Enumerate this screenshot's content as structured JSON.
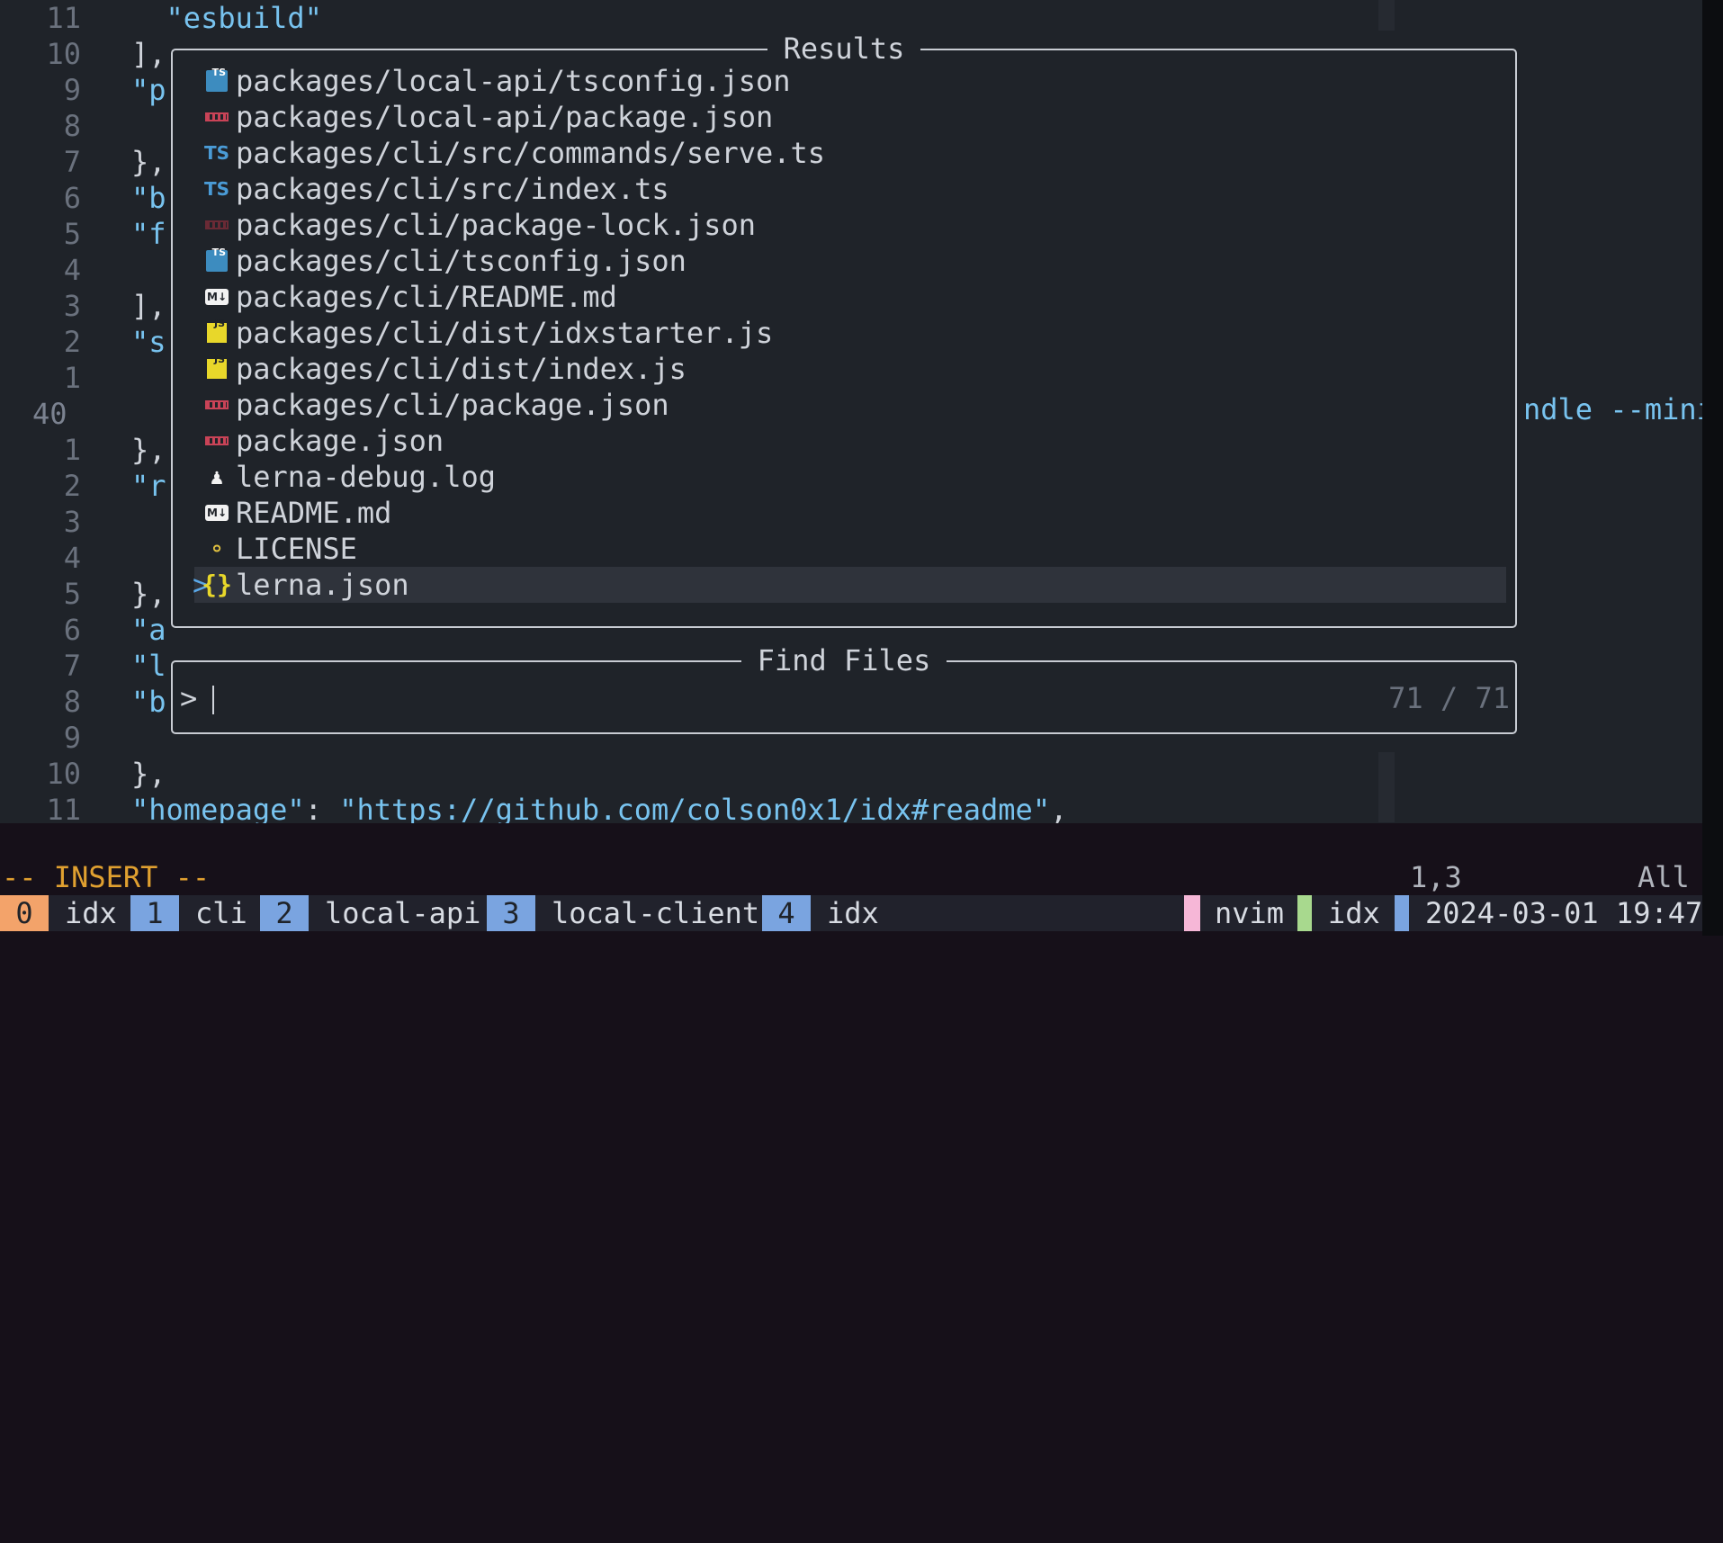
{
  "editor": {
    "lines": [
      {
        "num": "11",
        "code": "  \"esbuild\""
      },
      {
        "num": "10",
        "code": "],"
      },
      {
        "num": "9",
        "code": "\"p"
      },
      {
        "num": "8",
        "code": ""
      },
      {
        "num": "7",
        "code": "},"
      },
      {
        "num": "6",
        "code": "\"b"
      },
      {
        "num": "5",
        "code": "\"f"
      },
      {
        "num": "4",
        "code": ""
      },
      {
        "num": "3",
        "code": "],"
      },
      {
        "num": "2",
        "code": "\"s"
      },
      {
        "num": "1",
        "code": ""
      },
      {
        "num": "40",
        "code": ""
      },
      {
        "num": "1",
        "code": "},"
      },
      {
        "num": "2",
        "code": "\"r"
      },
      {
        "num": "3",
        "code": ""
      },
      {
        "num": "4",
        "code": ""
      },
      {
        "num": "5",
        "code": "},"
      },
      {
        "num": "6",
        "code": "\"a"
      },
      {
        "num": "7",
        "code": "\"l"
      },
      {
        "num": "8",
        "code": "\"b"
      },
      {
        "num": "9",
        "code": ""
      },
      {
        "num": "10",
        "code": "},"
      },
      {
        "num": "11",
        "code": "\"homepage\": \"https://github.com/colson0x1/idx#readme\","
      }
    ],
    "overflow_text": "ndle --mini"
  },
  "results": {
    "title": "Results",
    "items": [
      {
        "icon": "typescript-config-icon",
        "path": "packages/local-api/tsconfig.json"
      },
      {
        "icon": "npm-icon",
        "path": "packages/local-api/package.json"
      },
      {
        "icon": "typescript-icon",
        "path": "packages/cli/src/commands/serve.ts"
      },
      {
        "icon": "typescript-icon",
        "path": "packages/cli/src/index.ts"
      },
      {
        "icon": "npm-lock-icon",
        "path": "packages/cli/package-lock.json"
      },
      {
        "icon": "typescript-config-icon",
        "path": "packages/cli/tsconfig.json"
      },
      {
        "icon": "markdown-icon",
        "path": "packages/cli/README.md"
      },
      {
        "icon": "javascript-icon",
        "path": "packages/cli/dist/idxstarter.js"
      },
      {
        "icon": "javascript-icon",
        "path": "packages/cli/dist/index.js"
      },
      {
        "icon": "npm-icon",
        "path": "packages/cli/package.json"
      },
      {
        "icon": "npm-icon",
        "path": "package.json"
      },
      {
        "icon": "log-icon",
        "path": "lerna-debug.log"
      },
      {
        "icon": "markdown-icon",
        "path": "README.md"
      },
      {
        "icon": "license-icon",
        "path": "LICENSE"
      },
      {
        "icon": "json-icon",
        "path": "lerna.json"
      }
    ],
    "selected_marker": ">"
  },
  "find": {
    "title": "Find Files",
    "prompt": ">",
    "value": "",
    "counter": "71 / 71"
  },
  "cmdline": {
    "mode": "-- INSERT --",
    "position": "1,3",
    "scroll": "All"
  },
  "tmux": {
    "windows": [
      {
        "index": "0",
        "name": "idx",
        "active": true
      },
      {
        "index": "1",
        "name": "cli",
        "active": false
      },
      {
        "index": "2",
        "name": "local-api",
        "active": false
      },
      {
        "index": "3",
        "name": "local-client",
        "active": false
      },
      {
        "index": "4",
        "name": "idx",
        "active": false
      }
    ],
    "program": "nvim",
    "session": "idx",
    "datetime": "2024-03-01 19:47"
  }
}
